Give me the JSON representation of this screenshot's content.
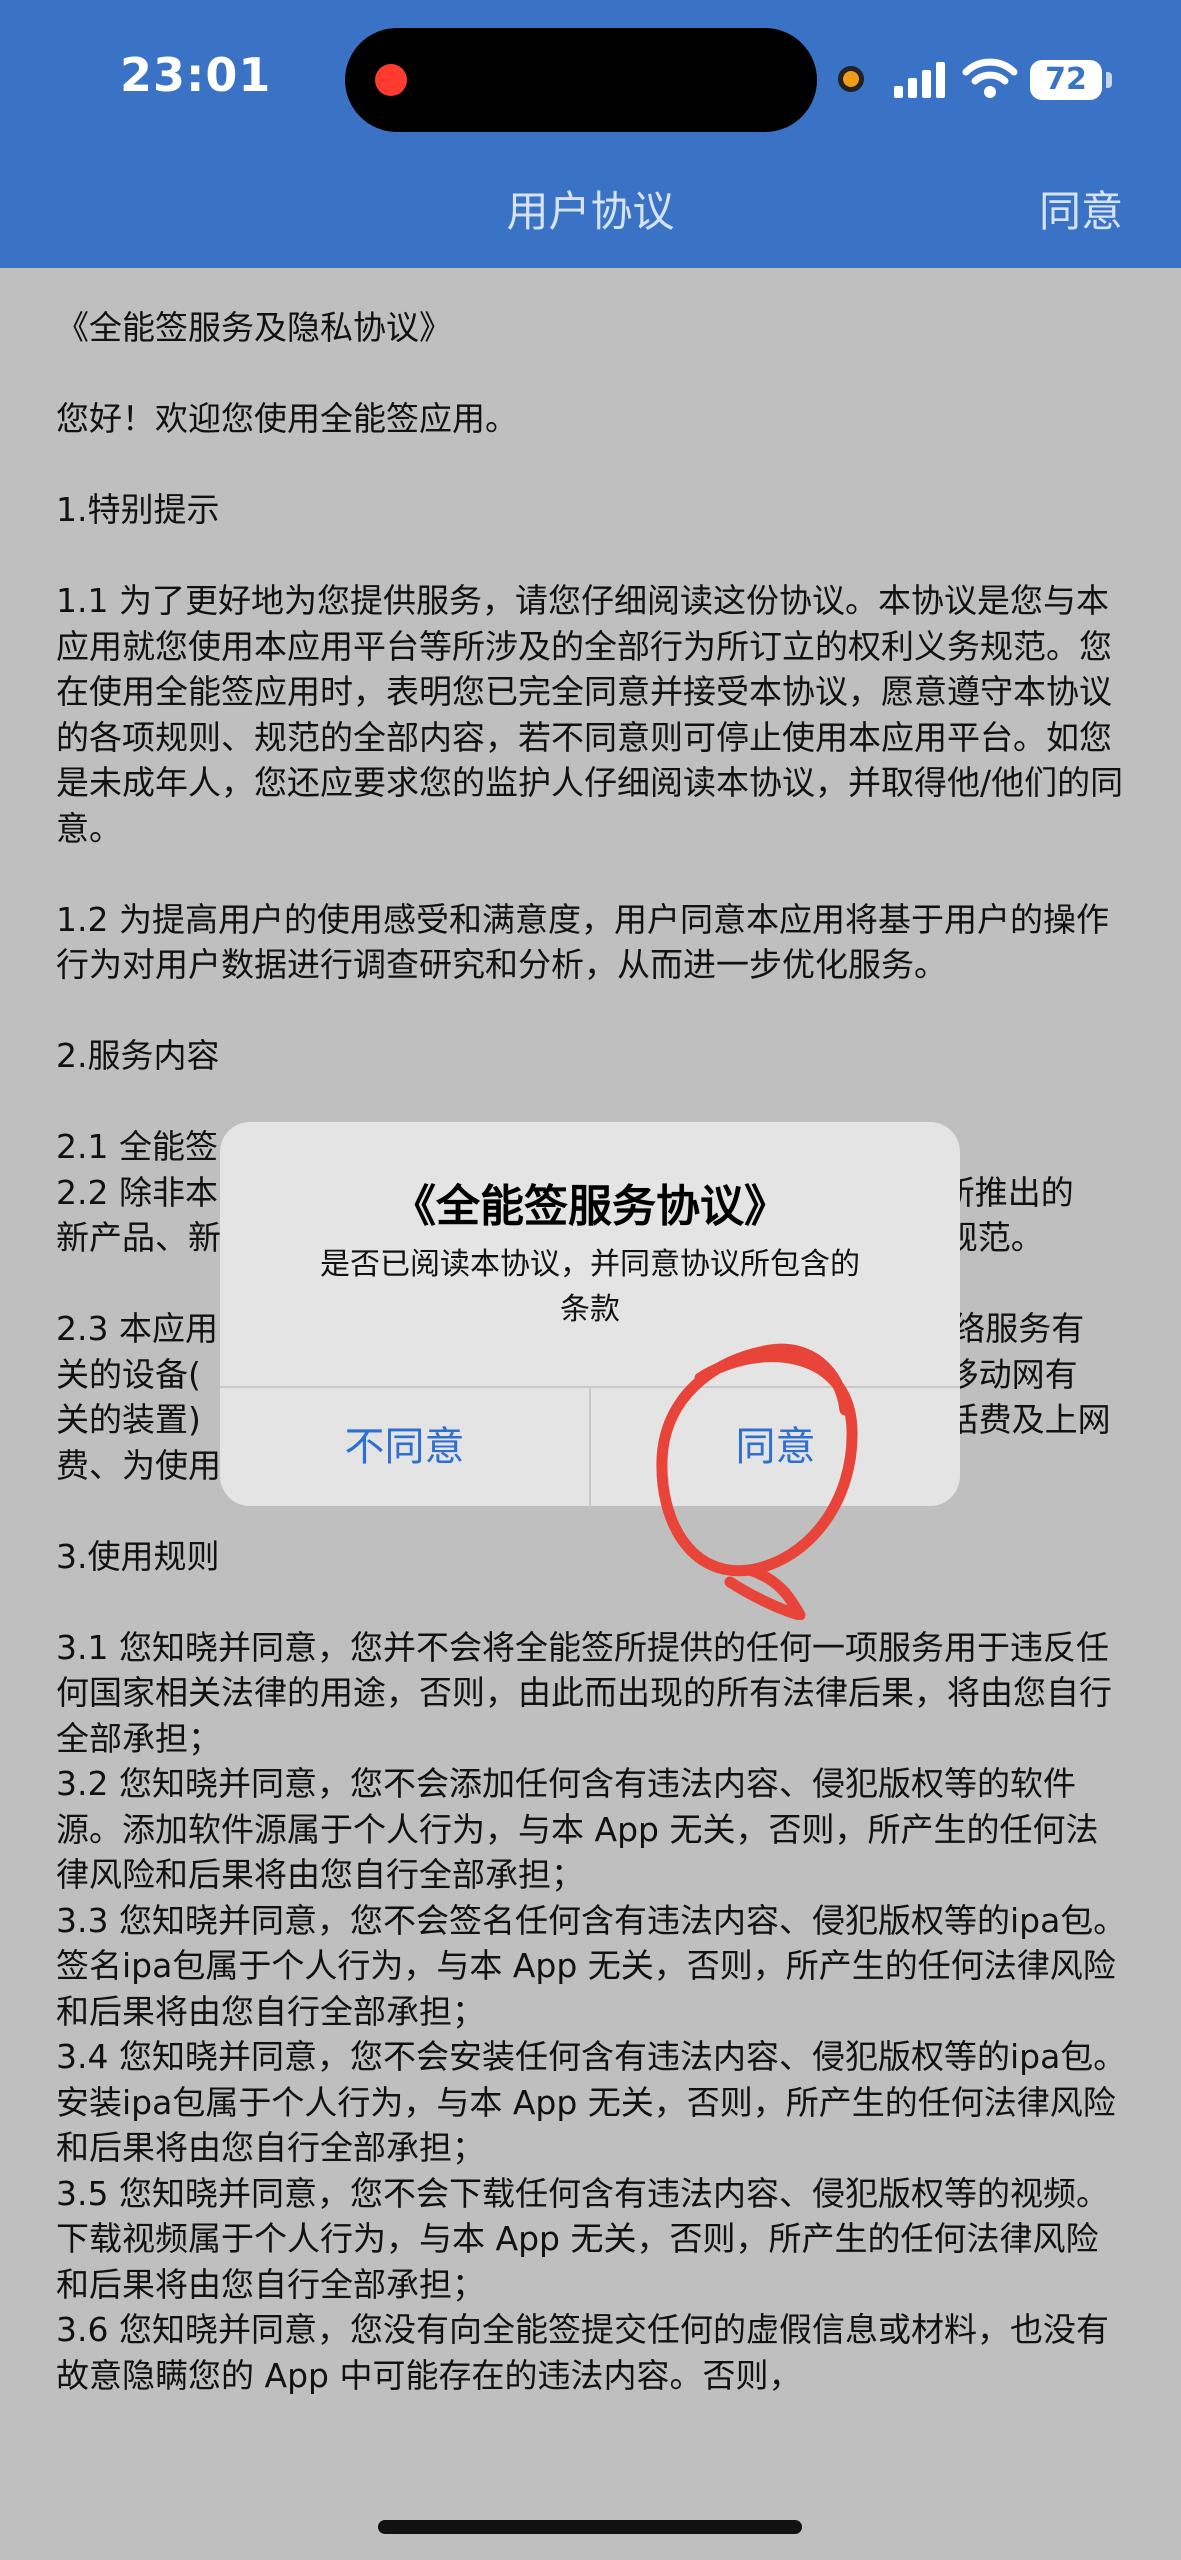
{
  "status_bar": {
    "time": "23:01",
    "battery": "72"
  },
  "nav": {
    "title": "用户协议",
    "agree_label": "同意"
  },
  "content": {
    "paragraphs": [
      "《全能签服务及隐私协议》",
      "您好！欢迎您使用全能签应用。",
      "1.特别提示",
      "1.1 为了更好地为您提供服务，请您仔细阅读这份协议。本协议是您与本应用就您使用本应用平台等所涉及的全部行为所订立的权利义务规范。您在使用全能签应用时，表明您已完全同意并接受本协议，愿意遵守本协议的各项规则、规范的全部内容，若不同意则可停止使用本应用平台。如您是未成年人，您还应要求您的监护人仔细阅读本协议，并取得他/他们的同意。",
      "1.2 为提高用户的使用感受和满意度，用户同意本应用将基于用户的操作行为对用户数据进行调查研究和分析，从而进一步优化服务。",
      "2.服务内容"
    ],
    "sec2_lines": [
      "2.1 全能签",
      "2.2 除非本                                                                     所推出的",
      "新产品、新                                                                     规范。"
    ],
    "sec23_lines": [
      "2.3 本应用                                                                      络服务有",
      "关的设备(                                                                       移动网有",
      "关的装置)                                                                       话费及上网",
      "费、为使用移动网而支付的手机费) 均应由用户自行负担。"
    ],
    "sec3_title": "3.使用规则",
    "sec3_items": [
      "3.1 您知晓并同意，您并不会将全能签所提供的任何一项服务用于违反任何国家相关法律的用途，否则，由此而出现的所有法律后果，将由您自行全部承担；",
      "3.2 您知晓并同意，您不会添加任何含有违法内容、侵犯版权等的软件源。添加软件源属于个人行为，与本 App 无关，否则，所产生的任何法律风险和后果将由您自行全部承担；",
      "3.3 您知晓并同意，您不会签名任何含有违法内容、侵犯版权等的ipa包。签名ipa包属于个人行为，与本 App 无关，否则，所产生的任何法律风险和后果将由您自行全部承担；",
      "3.4 您知晓并同意，您不会安装任何含有违法内容、侵犯版权等的ipa包。安装ipa包属于个人行为，与本 App 无关，否则，所产生的任何法律风险和后果将由您自行全部承担；",
      "3.5 您知晓并同意，您不会下载任何含有违法内容、侵犯版权等的视频。下载视频属于个人行为，与本 App 无关，否则，所产生的任何法律风险和后果将由您自行全部承担；",
      "3.6 您知晓并同意，您没有向全能签提交任何的虚假信息或材料，也没有故意隐瞒您的 App 中可能存在的违法内容。否则，"
    ]
  },
  "dialog": {
    "title": "《全能签服务协议》",
    "message": "是否已阅读本协议，并同意协议所包含的条款",
    "cancel_label": "不同意",
    "confirm_label": "同意"
  },
  "colors": {
    "nav_bar": "#3a73c5",
    "dialog_button": "#2f6fd0",
    "annotation": "#e8443a"
  }
}
